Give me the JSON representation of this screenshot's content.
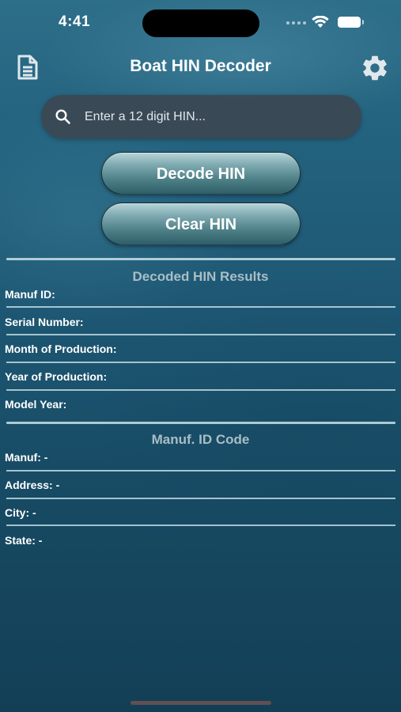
{
  "status_bar": {
    "time": "4:41"
  },
  "header": {
    "title": "Boat HIN Decoder",
    "left_icon": "document-icon",
    "right_icon": "gear-icon"
  },
  "search": {
    "placeholder": "Enter a 12 digit HIN...",
    "value": ""
  },
  "buttons": {
    "decode": "Decode HIN",
    "clear": "Clear HIN"
  },
  "results": {
    "heading": "Decoded HIN Results",
    "fields": [
      "Manuf ID:",
      "Serial Number:",
      "Month of Production:",
      "Year of Production:",
      "Model Year:"
    ]
  },
  "manuf": {
    "heading": "Manuf. ID Code",
    "fields": [
      "Manuf: -",
      "Address: -",
      "City: -",
      "State: -"
    ]
  },
  "colors": {
    "background_top": "#2d6e89",
    "background_bottom": "#133f56",
    "search_bg": "#3c4652",
    "section_heading": "#a9bec6"
  }
}
